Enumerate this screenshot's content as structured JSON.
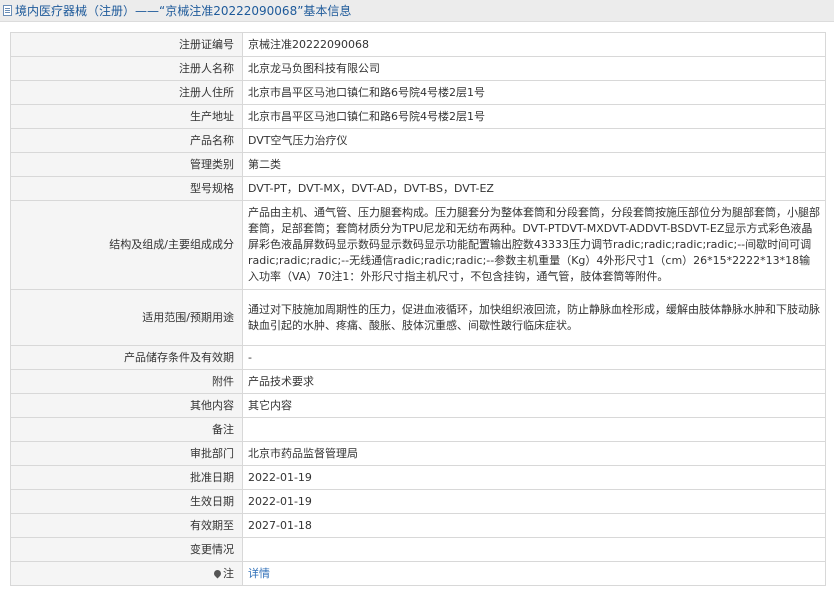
{
  "header": {
    "title": "境内医疗器械（注册）——“京械注准20222090068”基本信息"
  },
  "rows": [
    {
      "label": "注册证编号",
      "value": "京械注准20222090068"
    },
    {
      "label": "注册人名称",
      "value": "北京龙马负图科技有限公司"
    },
    {
      "label": "注册人住所",
      "value": "北京市昌平区马池口镇仁和路6号院4号楼2层1号"
    },
    {
      "label": "生产地址",
      "value": "北京市昌平区马池口镇仁和路6号院4号楼2层1号"
    },
    {
      "label": "产品名称",
      "value": "DVT空气压力治疗仪"
    },
    {
      "label": "管理类别",
      "value": "第二类"
    },
    {
      "label": "型号规格",
      "value": "DVT-PT，DVT-MX，DVT-AD，DVT-BS，DVT-EZ"
    },
    {
      "label": "结构及组成/主要组成成分",
      "value": "产品由主机、通气管、压力腿套构成。压力腿套分为整体套筒和分段套筒，分段套筒按施压部位分为腿部套筒，小腿部套筒，足部套筒；套筒材质分为TPU尼龙和无纺布两种。DVT-PTDVT-MXDVT-ADDVT-BSDVT-EZ显示方式彩色液晶屏彩色液晶屏数码显示数码显示数码显示功能配置输出腔数43333压力调节radic;radic;radic;radic;--间歇时间可调radic;radic;radic;--无线通信radic;radic;radic;--参数主机重量（Kg）4外形尺寸1（cm）26*15*2222*13*18输入功率（VA）70注1：外形尺寸指主机尺寸，不包含挂钩，通气管，肢体套筒等附件。"
    },
    {
      "label": "适用范围/预期用途",
      "value": "通过对下肢施加周期性的压力，促进血液循环，加快组织液回流，防止静脉血栓形成，缓解由肢体静脉水肿和下肢动脉缺血引起的水肿、疼痛、酸胀、肢体沉重感、间歇性跛行临床症状。"
    },
    {
      "label": "产品储存条件及有效期",
      "value": "-"
    },
    {
      "label": "附件",
      "value": "产品技术要求"
    },
    {
      "label": "其他内容",
      "value": "其它内容"
    },
    {
      "label": "备注",
      "value": ""
    },
    {
      "label": "审批部门",
      "value": "北京市药品监督管理局"
    },
    {
      "label": "批准日期",
      "value": "2022-01-19"
    },
    {
      "label": "生效日期",
      "value": "2022-01-19"
    },
    {
      "label": "有效期至",
      "value": "2027-01-18"
    },
    {
      "label": "变更情况",
      "value": ""
    }
  ],
  "note": {
    "label": "注",
    "link": "详情",
    "icon": "pin-icon"
  }
}
